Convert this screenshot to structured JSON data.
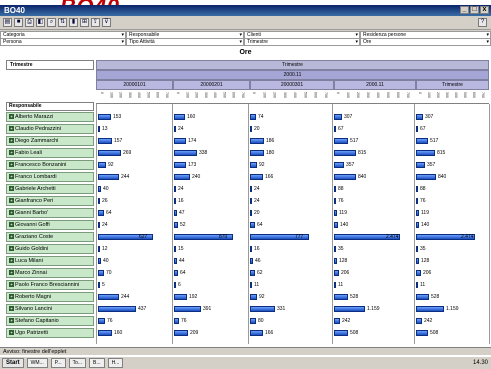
{
  "window": {
    "title": "BO40",
    "close": "x",
    "min": "_",
    "max": "□"
  },
  "toolbar": {
    "icons": [
      "open",
      "save",
      "print",
      "preview",
      "search",
      "sort",
      "chart",
      "pivot",
      "export",
      "filter",
      "help"
    ]
  },
  "filters": {
    "row1": [
      "Categoria",
      "Responsabile",
      "Clienti",
      "Residenza persone"
    ],
    "row2": [
      "Persona",
      "Tipo Attività",
      "Trimestre",
      "Ore"
    ]
  },
  "header": {
    "ore": "Ore",
    "trimestre_label": "Trimestre",
    "trimestre_band": "Trimestre",
    "year": "2000.11",
    "responsabile_label": "Responsabile"
  },
  "quarters": [
    "20000101",
    "20000201",
    "20000301",
    "2000.11",
    "Trimestre"
  ],
  "rows": [
    {
      "name": "Alberto Marazzi",
      "v": [
        153,
        160,
        74,
        307,
        307
      ]
    },
    {
      "name": "Claudio Pedrazzini",
      "v": [
        13,
        24,
        20,
        67,
        67
      ]
    },
    {
      "name": "Diego Zammarchi",
      "v": [
        157,
        174,
        186,
        517,
        517
      ]
    },
    {
      "name": "Fabio Leali",
      "v": [
        269,
        338,
        180,
        815,
        815
      ]
    },
    {
      "name": "Francesco Bonzanini",
      "v": [
        92,
        173,
        92,
        357,
        357
      ]
    },
    {
      "name": "Franco Lombardi",
      "v": [
        244,
        240,
        166,
        840,
        840
      ]
    },
    {
      "name": "Gabriele Archetti",
      "v": [
        40,
        24,
        24,
        88,
        88
      ]
    },
    {
      "name": "Gianfranco Peri",
      "v": [
        26,
        16,
        24,
        76,
        76
      ]
    },
    {
      "name": "Gianni Barbo'",
      "v": [
        64,
        47,
        20,
        119,
        119
      ]
    },
    {
      "name": "Giovanni Goffi",
      "v": [
        24,
        52,
        64,
        140,
        140
      ]
    },
    {
      "name": "Graziano Coste",
      "v": [
        627,
        870,
        777,
        "2.474",
        "2.474"
      ]
    },
    {
      "name": "Guido Goldini",
      "v": [
        12,
        15,
        16,
        35,
        35
      ]
    },
    {
      "name": "Luca Milani",
      "v": [
        40,
        44,
        46,
        128,
        128
      ]
    },
    {
      "name": "Marco Zinnai",
      "v": [
        70,
        64,
        62,
        206,
        206
      ]
    },
    {
      "name": "Paolo Franco Bresciannini",
      "v": [
        5,
        6,
        11,
        11,
        11
      ]
    },
    {
      "name": "Roberto Magni",
      "v": [
        244,
        192,
        92,
        528,
        528
      ]
    },
    {
      "name": "Silvano Lancini",
      "v": [
        437,
        391,
        331,
        "1.159",
        "1.159"
      ]
    },
    {
      "name": "Stefano Capitanio",
      "v": [
        76,
        76,
        80,
        242,
        242
      ]
    },
    {
      "name": "Ugo Patrizetti",
      "v": [
        160,
        209,
        166,
        508,
        508
      ]
    }
  ],
  "status": "Avviso: finestre dell'epplet",
  "taskbar": {
    "start": "Start",
    "tasks": [
      "WM...",
      "P...",
      "To...",
      "B...",
      "H..."
    ],
    "clock": "14.30"
  },
  "colors": {
    "accent": "#0a246a",
    "name_bg": "#c9e7c9",
    "bar": "#1c4fbf",
    "header_band": "#a6a6d6"
  }
}
